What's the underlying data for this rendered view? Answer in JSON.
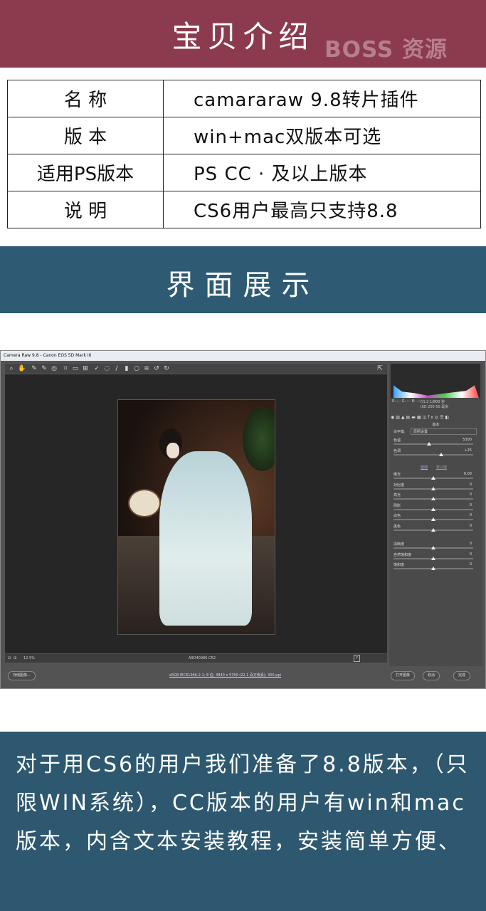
{
  "header": {
    "title": "宝贝介绍",
    "watermark": "BOSS 资源"
  },
  "spec_table": [
    {
      "key": "名  称",
      "value": "camararaw 9.8转片插件"
    },
    {
      "key": "版  本",
      "value": "win+mac双版本可选"
    },
    {
      "key": "适用PS版本",
      "value": "PS CC · 及以上版本"
    },
    {
      "key": "说  明",
      "value": "CS6用户最高只支持8.8"
    }
  ],
  "section2": {
    "title": "界面展示"
  },
  "camera_raw": {
    "window_title": "Camera Raw 9.8 - Canon EOS 5D Mark III",
    "zoom": "12.5%",
    "filename": "A9D40980.CR2",
    "workflow_link": "sRGB IEC61966-2.1; 8 位; 3840 x 5760 (22.1 百万像素); 300 ppi",
    "buttons": {
      "save": "存储图像...",
      "open": "打开图像",
      "cancel": "取消",
      "done": "完成"
    },
    "camera_info": {
      "aperture_shutter": "f/1.2  1/800 秒",
      "iso_focal": "ISO 200  50 毫米",
      "rgb": "R: ---  G: ---  B: ---"
    },
    "panel_title": "基本",
    "white_balance_label": "白平衡:",
    "white_balance_value": "原照设置",
    "auto_label": "自动",
    "default_label": "默认值",
    "sliders_wb": [
      {
        "name": "色温",
        "value": "5300",
        "pos": 0.45
      },
      {
        "name": "色调",
        "value": "+25",
        "pos": 0.6
      }
    ],
    "sliders_tone": [
      {
        "name": "曝光",
        "value": "0.00",
        "pos": 0.5
      },
      {
        "name": "对比度",
        "value": "0",
        "pos": 0.5
      },
      {
        "name": "高光",
        "value": "0",
        "pos": 0.5
      },
      {
        "name": "阴影",
        "value": "0",
        "pos": 0.5
      },
      {
        "name": "白色",
        "value": "0",
        "pos": 0.5
      },
      {
        "name": "黑色",
        "value": "0",
        "pos": 0.5
      }
    ],
    "sliders_presence": [
      {
        "name": "清晰度",
        "value": "0",
        "pos": 0.5
      },
      {
        "name": "自然饱和度",
        "value": "0",
        "pos": 0.5
      },
      {
        "name": "饱和度",
        "value": "0",
        "pos": 0.5
      }
    ]
  },
  "footer": {
    "text": "对于用CS6的用户我们准备了8.8版本，（只限WIN系统），CC版本的用户有win和mac版本，内含文本安装教程，安装简单方便、"
  },
  "colors": {
    "header": "#8b3b4d",
    "section": "#2e5a73",
    "footer": "#2d586f"
  }
}
